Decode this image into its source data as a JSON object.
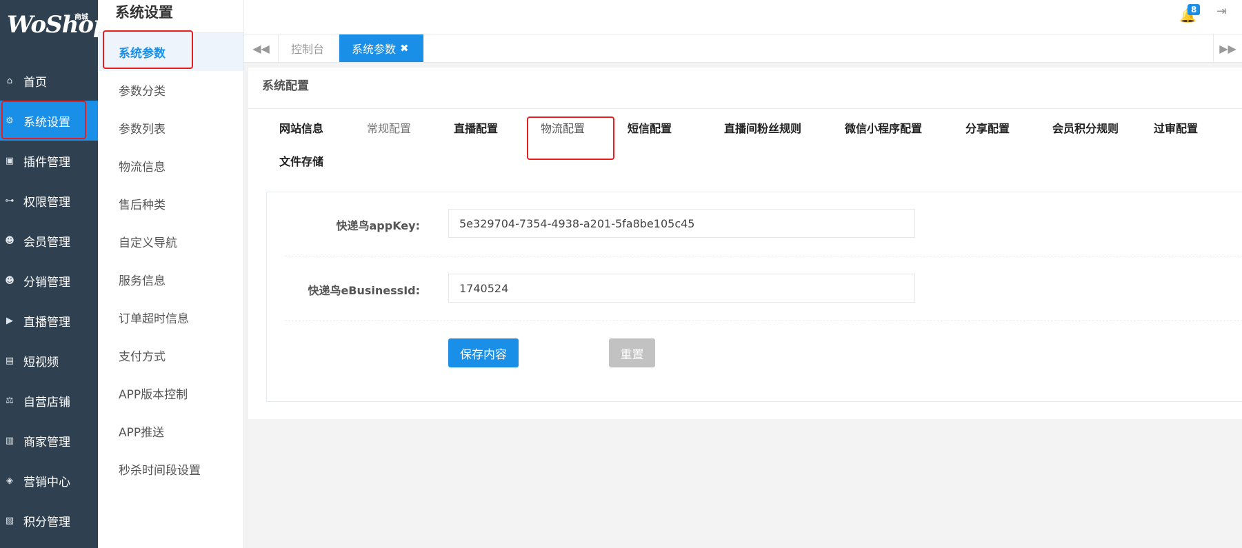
{
  "logo": {
    "brand": "WoShop",
    "sub": "商城"
  },
  "nav": [
    {
      "label": "首页",
      "icon": "home-icon",
      "glyph": "⌂"
    },
    {
      "label": "系统设置",
      "icon": "gear-icon",
      "glyph": "⚙"
    },
    {
      "label": "插件管理",
      "icon": "plugin-icon",
      "glyph": "▣"
    },
    {
      "label": "权限管理",
      "icon": "sitemap-icon",
      "glyph": "⊶"
    },
    {
      "label": "会员管理",
      "icon": "users-icon",
      "glyph": "☻"
    },
    {
      "label": "分销管理",
      "icon": "users-icon",
      "glyph": "☻"
    },
    {
      "label": "直播管理",
      "icon": "video-camera-icon",
      "glyph": "▶"
    },
    {
      "label": "短视频",
      "icon": "file-icon",
      "glyph": "▤"
    },
    {
      "label": "自营店铺",
      "icon": "balance-scale-icon",
      "glyph": "⚖"
    },
    {
      "label": "商家管理",
      "icon": "bank-icon",
      "glyph": "▥"
    },
    {
      "label": "营销中心",
      "icon": "tag-icon",
      "glyph": "◈"
    },
    {
      "label": "积分管理",
      "icon": "points-icon",
      "glyph": "▧"
    }
  ],
  "submenu": {
    "title": "系统设置",
    "items": [
      "系统参数",
      "参数分类",
      "参数列表",
      "物流信息",
      "售后种类",
      "自定义导航",
      "服务信息",
      "订单超时信息",
      "支付方式",
      "APP版本控制",
      "APP推送",
      "秒杀时间段设置"
    ]
  },
  "topbar": {
    "badge": "8"
  },
  "tabs": {
    "console": "控制台",
    "current": "系统参数",
    "close": "✖"
  },
  "panel": {
    "title": "系统配置",
    "tabs": [
      "网站信息",
      "常规配置",
      "直播配置",
      "物流配置",
      "短信配置",
      "直播间粉丝规则",
      "微信小程序配置",
      "分享配置",
      "会员积分规则",
      "过审配置",
      "文件存储"
    ]
  },
  "form": {
    "appkey_label": "快递鸟appKey:",
    "appkey_value": "5e329704-7354-4938-a201-5fa8be105c45",
    "business_label": "快递鸟eBusinessId:",
    "business_value": "1740524",
    "save_label": "保存内容",
    "reset_label": "重置"
  },
  "colors": {
    "sidebar": "#2f4050",
    "accent": "#1a8fe8",
    "highlight": "#e61e1e"
  }
}
